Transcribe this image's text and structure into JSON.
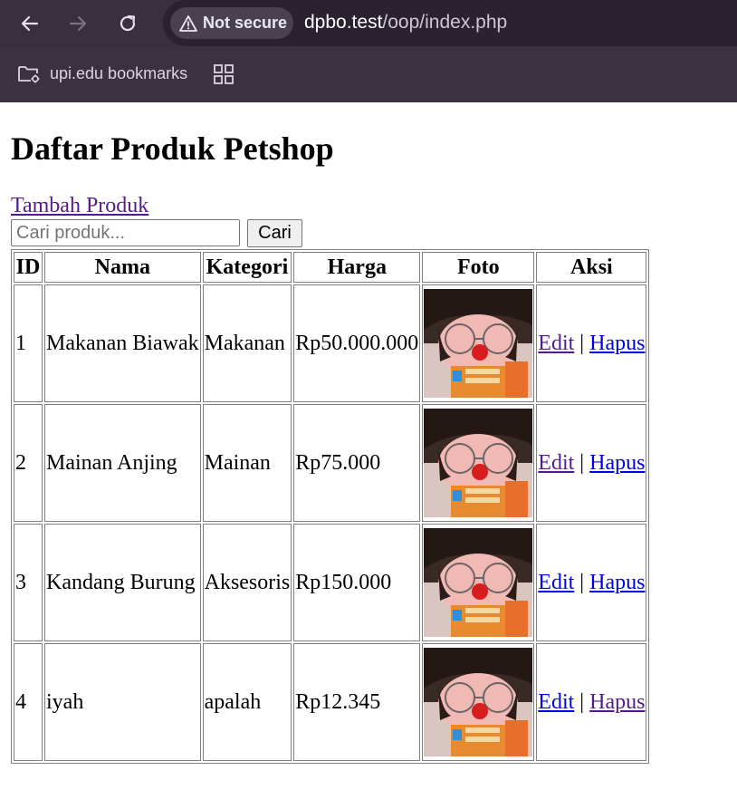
{
  "browser": {
    "security_label": "Not secure",
    "url_host": "dpbo.test",
    "url_path": "/oop/index.php",
    "bookmark_folder_label": "upi.edu bookmarks"
  },
  "page": {
    "title": "Daftar Produk Petshop",
    "add_link": "Tambah Produk",
    "search_placeholder": "Cari produk...",
    "search_value": "",
    "search_button": "Cari"
  },
  "table": {
    "headers": [
      "ID",
      "Nama",
      "Kategori",
      "Harga",
      "Foto",
      "Aksi"
    ],
    "rows": [
      {
        "id": "1",
        "nama": "Makanan Biawak",
        "kategori": "Makanan",
        "harga": "Rp50.000.000",
        "edit": "Edit",
        "sep": "|",
        "hapus": "Hapus"
      },
      {
        "id": "2",
        "nama": "Mainan Anjing",
        "kategori": "Mainan",
        "harga": "Rp75.000",
        "edit": "Edit",
        "sep": "|",
        "hapus": "Hapus"
      },
      {
        "id": "3",
        "nama": "Kandang Burung",
        "kategori": "Aksesoris",
        "harga": "Rp150.000",
        "edit": "Edit",
        "sep": "|",
        "hapus": "Hapus"
      },
      {
        "id": "4",
        "nama": "iyah",
        "kategori": "apalah",
        "harga": "Rp12.345",
        "edit": "Edit",
        "sep": "|",
        "hapus": "Hapus"
      }
    ]
  },
  "colors": {
    "link_visited": "#551a8b",
    "link_unvisited": "#0000ee",
    "chrome_bg": "#3a2f3f"
  }
}
